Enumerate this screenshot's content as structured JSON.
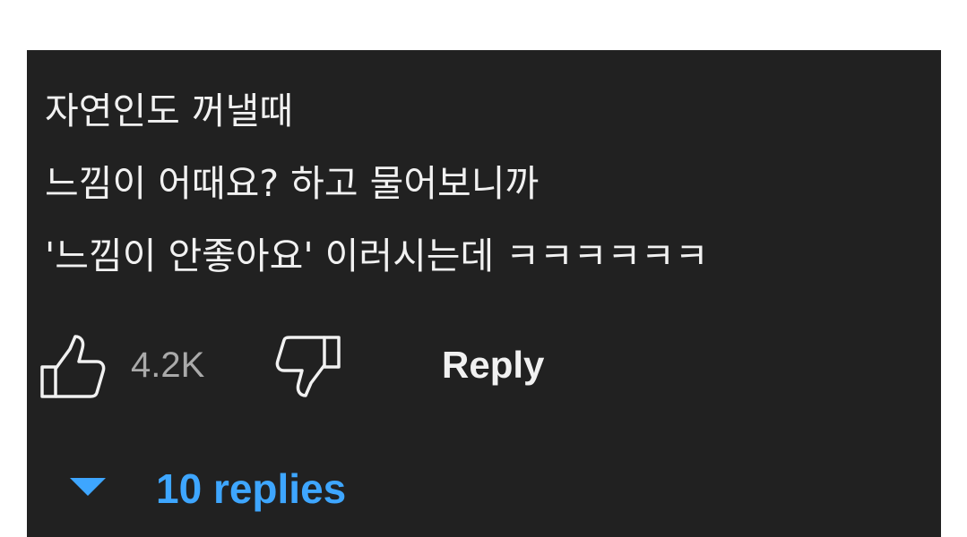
{
  "comment": {
    "lines": [
      "자연인도 꺼낼때",
      "느낌이 어때요? 하고 물어보니까",
      "'느낌이 안좋아요' 이러시는데 ㅋㅋㅋㅋㅋㅋ"
    ]
  },
  "actions": {
    "like_icon": "thumbs-up-icon",
    "like_count": "4.2K",
    "dislike_icon": "thumbs-down-icon",
    "reply_label": "Reply"
  },
  "replies": {
    "toggle_icon": "caret-down-icon",
    "label": "10 replies"
  },
  "colors": {
    "background": "#212121",
    "text": "#f1f1f1",
    "muted": "#aaaaaa",
    "accent": "#3ea6ff"
  }
}
